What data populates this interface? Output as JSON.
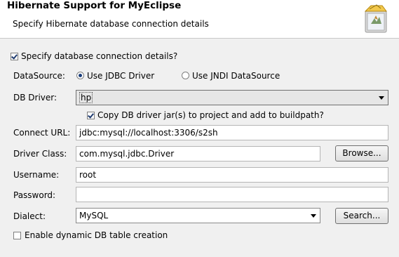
{
  "header": {
    "title": "Hibernate Support for MyEclipse",
    "subtitle": "Specify Hibernate database connection details",
    "icon": "hibernate-wizard-icon"
  },
  "specify_details": {
    "label": "Specify database connection details?",
    "checked": true
  },
  "datasource": {
    "label": "DataSource:",
    "options": [
      "Use JDBC Driver",
      "Use JNDI DataSource"
    ],
    "selected": "Use JDBC Driver"
  },
  "db_driver": {
    "label": "DB Driver:",
    "value": "hp"
  },
  "copy_jar": {
    "label": "Copy DB driver jar(s) to project and add to buildpath?",
    "checked": true
  },
  "connect_url": {
    "label": "Connect URL:",
    "value": "jdbc:mysql://localhost:3306/s2sh"
  },
  "driver_class": {
    "label": "Driver Class:",
    "value": "com.mysql.jdbc.Driver",
    "button": "Browse..."
  },
  "username": {
    "label": "Username:",
    "value": "root"
  },
  "password": {
    "label": "Password:",
    "value": ""
  },
  "dialect": {
    "label": "Dialect:",
    "value": "MySQL",
    "button": "Search..."
  },
  "dynamic_table": {
    "label": "Enable dynamic DB table creation",
    "checked": false
  }
}
